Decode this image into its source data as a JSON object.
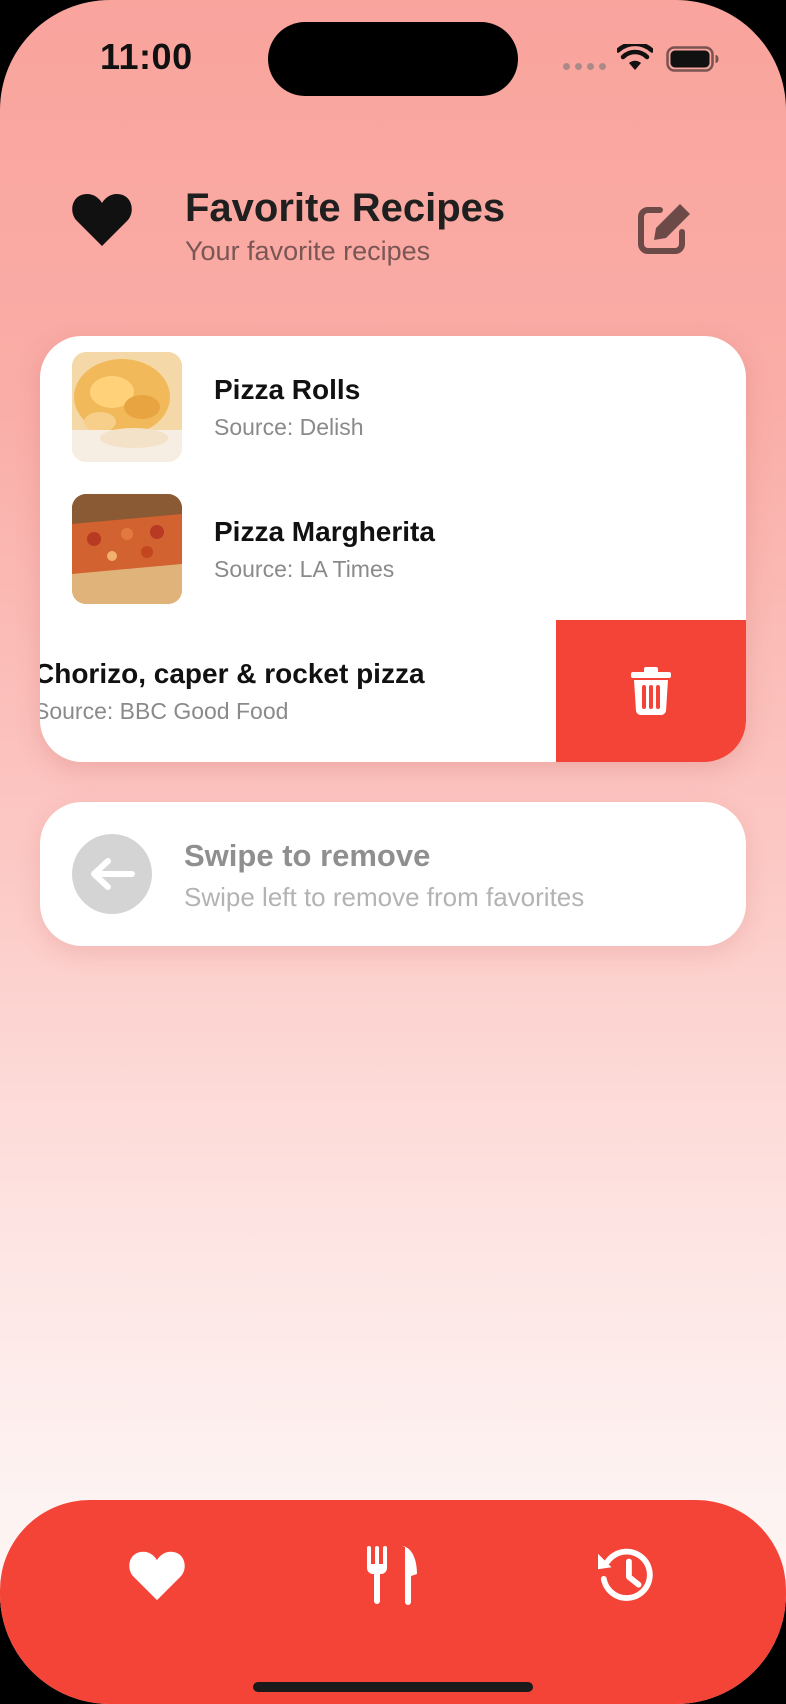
{
  "status_bar": {
    "time": "11:00",
    "wifi_icon": "wifi-icon",
    "battery_icon": "battery-icon"
  },
  "header": {
    "icon": "heart-icon",
    "title": "Favorite Recipes",
    "subtitle": "Your favorite recipes",
    "edit_icon": "edit-icon"
  },
  "recipes": [
    {
      "title": "Pizza Rolls",
      "source": "Source: Delish"
    },
    {
      "title": "Pizza Margherita",
      "source": "Source: LA Times"
    },
    {
      "title": "Chorizo, caper & rocket pizza",
      "source": "Source: BBC Good Food",
      "swiped": true
    }
  ],
  "delete_action": {
    "icon": "trash-icon",
    "color": "#f44337"
  },
  "hint": {
    "icon": "arrow-left-icon",
    "title": "Swipe to remove",
    "subtitle": "Swipe left to remove from favorites"
  },
  "tab_bar": {
    "color": "#f44337",
    "tabs": [
      {
        "icon": "heart-icon",
        "active": true
      },
      {
        "icon": "fork-knife-icon",
        "active": false
      },
      {
        "icon": "history-icon",
        "active": false
      }
    ]
  },
  "colors": {
    "accent": "#f44337",
    "background_top": "#f9a49d",
    "background_bottom": "#fef6f5"
  }
}
